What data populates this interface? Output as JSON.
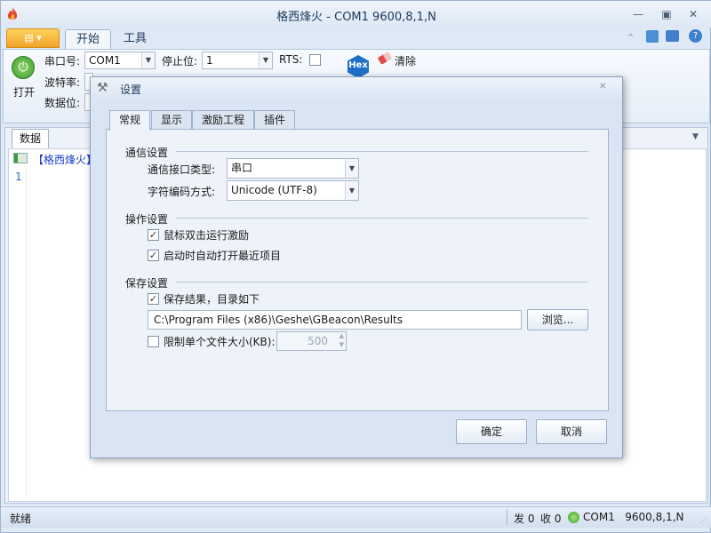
{
  "window": {
    "title": "格西烽火 - COM1  9600,8,1,N"
  },
  "ribbon": {
    "tabs": [
      {
        "label": "开始"
      },
      {
        "label": "工具"
      }
    ],
    "open_label": "打开",
    "port_label": "串口号:",
    "port_value": "COM1",
    "stop_label": "停止位:",
    "stop_value": "1",
    "rts_label": "RTS:",
    "baud_label": "波特率:",
    "data_label": "数据位:",
    "hex_label": "Hex",
    "clear_label": "清除"
  },
  "document": {
    "tab_label": "数据",
    "header_text": "【格西烽火】",
    "line_number": "1"
  },
  "statusbar": {
    "left_text": "就绪",
    "sent": "发 0",
    "received": "收 0",
    "port_status": "COM1   9600,8,1,N"
  },
  "dialog": {
    "title": "设置",
    "tabs": [
      {
        "label": "常规"
      },
      {
        "label": "显示"
      },
      {
        "label": "激励工程"
      },
      {
        "label": "插件"
      }
    ],
    "comm_group": "通信设置",
    "iface_label": "通信接口类型:",
    "iface_value": "串口",
    "encoding_label": "字符编码方式:",
    "encoding_value": "Unicode (UTF-8)",
    "op_group": "操作设置",
    "dblclick_label": "鼠标双击运行激励",
    "autoopen_label": "启动时自动打开最近项目",
    "save_group": "保存设置",
    "save_results_label": "保存结果，目录如下",
    "save_path": "C:\\Program Files (x86)\\Geshe\\GBeacon\\Results",
    "browse_label": "浏览...",
    "limit_label": "限制单个文件大小(KB):",
    "limit_value": "500",
    "ok_label": "确定",
    "cancel_label": "取消"
  }
}
